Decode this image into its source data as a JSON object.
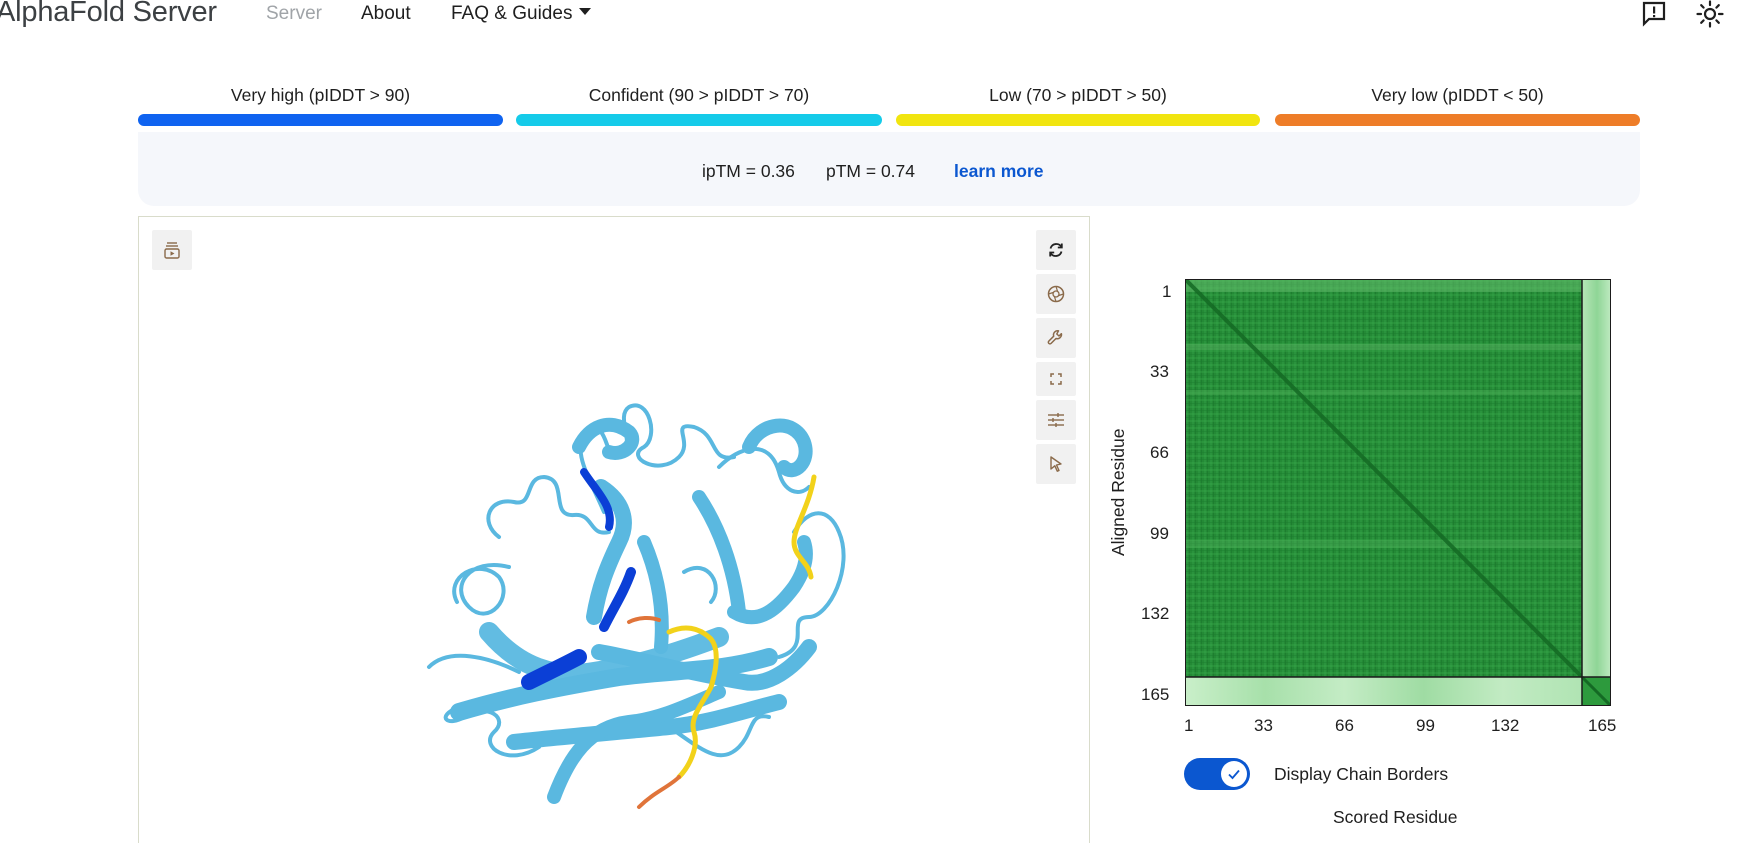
{
  "header": {
    "brand": "AlphaFold Server",
    "nav": {
      "server": "Server",
      "about": "About",
      "faq": "FAQ & Guides"
    },
    "icons": {
      "feedback": "feedback-icon",
      "theme": "brightness-icon"
    }
  },
  "confidence_legend": [
    {
      "label": "Very high (pIDDT > 90)",
      "color": "#0f63f0"
    },
    {
      "label": "Confident (90 > pIDDT > 70)",
      "color": "#15cbe9"
    },
    {
      "label": "Low (70 > pIDDT > 50)",
      "color": "#f1e50f"
    },
    {
      "label": "Very low (pIDDT < 50)",
      "color": "#ee7d28"
    }
  ],
  "scores": {
    "iptm": "ipTM = 0.36",
    "ptm": "pTM = 0.74",
    "learn_more": "learn more"
  },
  "viewer": {
    "icons": [
      "animation-icon",
      "spin-icon",
      "screenshot-icon",
      "wrench-icon",
      "fullscreen-icon",
      "settings-sliders-icon",
      "cursor-icon"
    ],
    "colors": {
      "main": "#5ab8e0",
      "high": "#0b3fd6",
      "low": "#f2d21a",
      "very_low": "#e0743a"
    }
  },
  "pae": {
    "y_label": "Aligned Residue",
    "x_label": "Scored Residue",
    "y_ticks": [
      "1",
      "33",
      "66",
      "99",
      "132",
      "165"
    ],
    "x_ticks": [
      "1",
      "33",
      "66",
      "99",
      "132",
      "165"
    ],
    "chain_border_toggle": {
      "label": "Display Chain Borders",
      "checked": true
    },
    "colors": {
      "dark": "#1c7f2f",
      "light": "#c9efc9"
    }
  }
}
